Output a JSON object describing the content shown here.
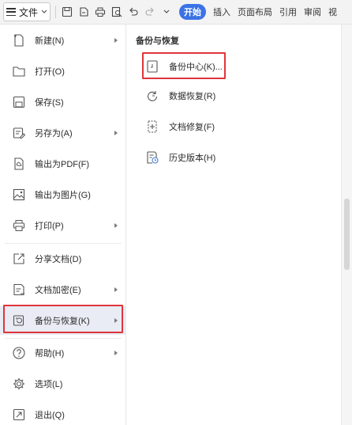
{
  "toolbar": {
    "file_label": "文件",
    "start_tab": "开始",
    "tabs": [
      "插入",
      "页面布局",
      "引用",
      "审阅",
      "视"
    ]
  },
  "menu": {
    "items": [
      {
        "label": "新建(N)",
        "icon": "new-file-icon",
        "has_arrow": true
      },
      {
        "label": "打开(O)",
        "icon": "folder-open-icon",
        "has_arrow": false
      },
      {
        "label": "保存(S)",
        "icon": "save-icon",
        "has_arrow": false
      },
      {
        "label": "另存为(A)",
        "icon": "save-as-icon",
        "has_arrow": true
      },
      {
        "label": "输出为PDF(F)",
        "icon": "export-pdf-icon",
        "has_arrow": false
      },
      {
        "label": "输出为图片(G)",
        "icon": "export-image-icon",
        "has_arrow": false
      },
      {
        "label": "打印(P)",
        "icon": "print-icon",
        "has_arrow": true
      },
      {
        "label": "分享文档(D)",
        "icon": "share-icon",
        "has_arrow": false
      },
      {
        "label": "文档加密(E)",
        "icon": "encrypt-icon",
        "has_arrow": true
      },
      {
        "label": "备份与恢复(K)",
        "icon": "backup-restore-icon",
        "has_arrow": true,
        "active": true
      },
      {
        "label": "帮助(H)",
        "icon": "help-icon",
        "has_arrow": true
      },
      {
        "label": "选项(L)",
        "icon": "gear-icon",
        "has_arrow": false
      },
      {
        "label": "退出(Q)",
        "icon": "exit-icon",
        "has_arrow": false
      }
    ]
  },
  "submenu": {
    "title": "备份与恢复",
    "items": [
      {
        "label": "备份中心(K)...",
        "icon": "backup-center-icon"
      },
      {
        "label": "数据恢复(R)",
        "icon": "data-recovery-icon"
      },
      {
        "label": "文档修复(F)",
        "icon": "doc-repair-icon"
      },
      {
        "label": "历史版本(H)",
        "icon": "history-version-icon"
      }
    ]
  },
  "colors": {
    "accent": "#3b73e6",
    "highlight_border": "#e0353c",
    "active_row": "#e9ecf4"
  }
}
